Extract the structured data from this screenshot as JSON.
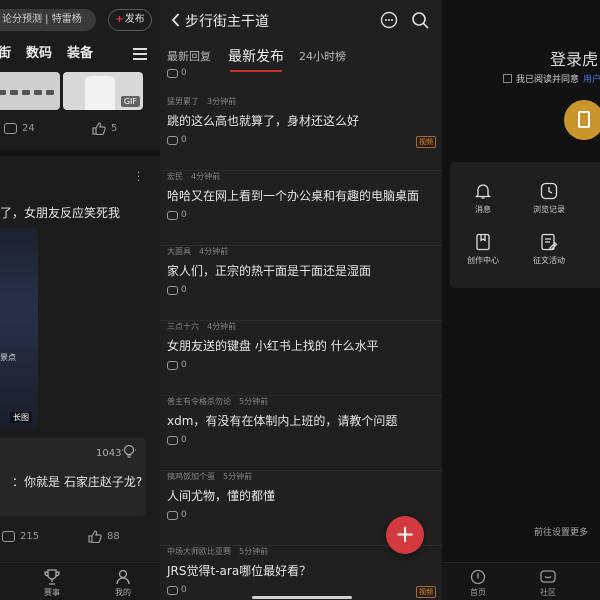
{
  "left_panel": {
    "search_text": "论分预测 | 特雷杨",
    "publish_label": "发布",
    "nav": [
      "街",
      "数码",
      "装备"
    ],
    "gif_badge": "GIF",
    "card1_comments": "24",
    "card1_likes": "5",
    "post_title": "了，女朋友反应笑死我",
    "photo_tag": "景点",
    "photo_label": "长图",
    "count": "1043",
    "quote": "：你就是 石家庄赵子龙?",
    "card2_comments": "215",
    "card2_likes": "88",
    "bottom_tabs": [
      "赛事",
      "我的"
    ]
  },
  "middle_panel": {
    "title": "步行街主干道",
    "tabs": [
      {
        "label": "最新回复",
        "active": false
      },
      {
        "label": "最新发布",
        "active": true
      },
      {
        "label": "24小时榜",
        "active": false
      }
    ],
    "top_partial_comments": "0",
    "posts": [
      {
        "author": "猛男累了",
        "time": "3分钟前",
        "title": "跳的这么高也就算了，身材还这么好",
        "comments": "0",
        "badge": "视频"
      },
      {
        "author": "宏民",
        "time": "4分钟前",
        "title": "哈哈又在网上看到一个办公桌和有趣的电脑桌面",
        "comments": "0",
        "badge": ""
      },
      {
        "author": "大面具",
        "time": "4分钟前",
        "title": "家人们，正宗的热干面是干面还是湿面",
        "comments": "0",
        "badge": ""
      },
      {
        "author": "三点十六",
        "time": "4分钟前",
        "title": "女朋友送的键盘 小红书上找的 什么水平",
        "comments": "0",
        "badge": ""
      },
      {
        "author": "普主有令格杀勿论",
        "time": "5分钟前",
        "title": "xdm，有没有在体制内上班的，请教个问题",
        "comments": "0",
        "badge": ""
      },
      {
        "author": "搞鸡饭加个蛋",
        "time": "5分钟前",
        "title": "人间尤物，懂的都懂",
        "comments": "0",
        "badge": ""
      },
      {
        "author": "中场大师欧比亚赛",
        "time": "5分钟前",
        "title": "JRS觉得t-ara哪位最好看？",
        "comments": "0",
        "badge": "视频"
      }
    ],
    "fab_label": "+"
  },
  "right_panel": {
    "login_title": "登录虎",
    "agree_text": "我已阅读并同意",
    "agree_link": "用户",
    "grid": [
      {
        "label": "消息",
        "icon": "bell-icon"
      },
      {
        "label": "浏览记录",
        "icon": "clock-icon"
      },
      {
        "label": "创作中心",
        "icon": "bookmark-icon"
      },
      {
        "label": "征文活动",
        "icon": "edit-doc-icon"
      }
    ],
    "settings_note": "前往设置更多",
    "bottom_tabs": [
      "首页",
      "社区"
    ]
  },
  "colors": {
    "accent_red": "#d23a3e",
    "video_orange": "#e8862b",
    "link_blue": "#3d7ad8",
    "gold": "#c9962e"
  }
}
